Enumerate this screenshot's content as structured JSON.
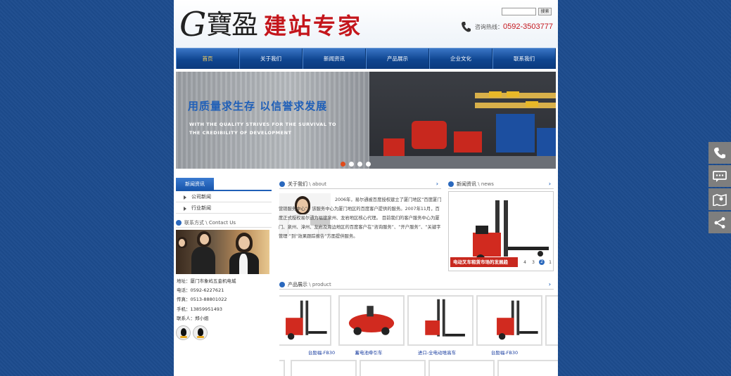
{
  "header": {
    "logo_g": "G",
    "logo_bao": "寶盈",
    "logo_text": "建站专家",
    "search_placeholder": "",
    "search_button": "搜索",
    "hotline_label": "咨询热线：",
    "hotline_number": "0592-3503777"
  },
  "nav": {
    "items": [
      "首页",
      "关于我们",
      "新闻资讯",
      "产品展示",
      "企业文化",
      "联系我们"
    ],
    "active_index": 0
  },
  "banner": {
    "title": "用质量求生存 以信誉求发展",
    "subtitle": "WITH THE QUALITY STRIVES FOR THE SURVIVAL TO THE CREDIBILITY OF DEVELOPMENT",
    "dots": 4,
    "active_dot": 0
  },
  "sidebar": {
    "news_tab": "新闻资讯",
    "links": [
      "公司新闻",
      "行业新闻"
    ],
    "contact_head": "联系方式",
    "contact_head_en": "Contact Us",
    "address": "地址：厦门市象屿五金机电城",
    "phone": "电话：0592-6227621",
    "fax": "传真：0513-88801022",
    "mobile": "手机：13859951493",
    "contact_person": "联系人：郑小姐"
  },
  "about": {
    "head": "关于我们",
    "head_en": "about",
    "text": "2006年，易尔通被百度授权建立了厦门地区“百度厦门营销服务中心”，该服务中心为厦门地区的百度客户提供的服务。2007年11月，百度正式授权易尔通为福建泉州、龙岩地区核心代理。 目前我们的客户服务中心为厦门、泉州、漳州、龙岩及周边地区的百度客户在“咨询服务”、“开户服务”、“关键字管理 ”到“效果跟踪报告”方面提供服务。"
  },
  "news": {
    "head": "新闻资讯",
    "head_en": "news",
    "caption": "电动叉车租赁市场的发展趋",
    "pages": [
      "4",
      "3",
      "2",
      "1"
    ],
    "active_page": "2"
  },
  "products": {
    "head": "产品展示",
    "head_en": "product",
    "items": [
      "台励福-FB30",
      "蓄电池牵引车",
      "进口-全电动堆高车",
      "台励福-FB30"
    ]
  },
  "float_bar": {
    "icons": [
      "phone-icon",
      "chat-icon",
      "map-icon",
      "share-icon"
    ]
  },
  "colors": {
    "background": "#1d4c8e",
    "nav": "#0f4590",
    "accent_red": "#c4161c",
    "link_blue": "#1a3ea0"
  }
}
